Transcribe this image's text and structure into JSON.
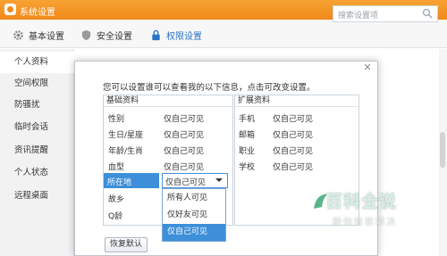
{
  "window": {
    "title": "系统设置"
  },
  "toolbar": {
    "tabs": [
      {
        "label": "基本设置",
        "icon": "gear-icon"
      },
      {
        "label": "安全设置",
        "icon": "shield-icon"
      },
      {
        "label": "权限设置",
        "icon": "lock-icon",
        "active": true
      }
    ],
    "search_placeholder": "搜索设置项"
  },
  "sidebar": {
    "items": [
      {
        "label": "个人资料",
        "active": true
      },
      {
        "label": "空间权限"
      },
      {
        "label": "防骚扰"
      },
      {
        "label": "临时会话"
      },
      {
        "label": "资讯提醒"
      },
      {
        "label": "个人状态"
      },
      {
        "label": "远程桌面"
      }
    ]
  },
  "dialog": {
    "prompt": "您可以设置谁可以查看我的以下信息，点击可改变设置。",
    "basic": {
      "header": "基础资料",
      "rows": [
        {
          "label": "性别",
          "value": "仅自己可见"
        },
        {
          "label": "生日/星座",
          "value": "仅自己可见"
        },
        {
          "label": "年龄/生肖",
          "value": "仅自己可见"
        },
        {
          "label": "血型",
          "value": "仅自己可见"
        },
        {
          "label": "所在地",
          "value": "仅自己可见"
        },
        {
          "label": "故乡",
          "value": ""
        },
        {
          "label": "Q龄",
          "value": ""
        }
      ]
    },
    "extended": {
      "header": "扩展资料",
      "rows": [
        {
          "label": "手机",
          "value": "仅自己可见"
        },
        {
          "label": "邮箱",
          "value": "仅自己可见"
        },
        {
          "label": "职业",
          "value": "仅自己可见"
        },
        {
          "label": "学校",
          "value": "仅自己可见"
        }
      ]
    },
    "dropdown": {
      "selected": "仅自己可见",
      "options": [
        "所有人可见",
        "仅好友可见",
        "仅自己可见"
      ]
    },
    "restore_label": "恢复默认"
  },
  "watermark": {
    "title": "百科全说",
    "subtitle": "助你轻松解决"
  },
  "colors": {
    "titlebar": "#f0891a",
    "accent": "#3d8fd9"
  }
}
